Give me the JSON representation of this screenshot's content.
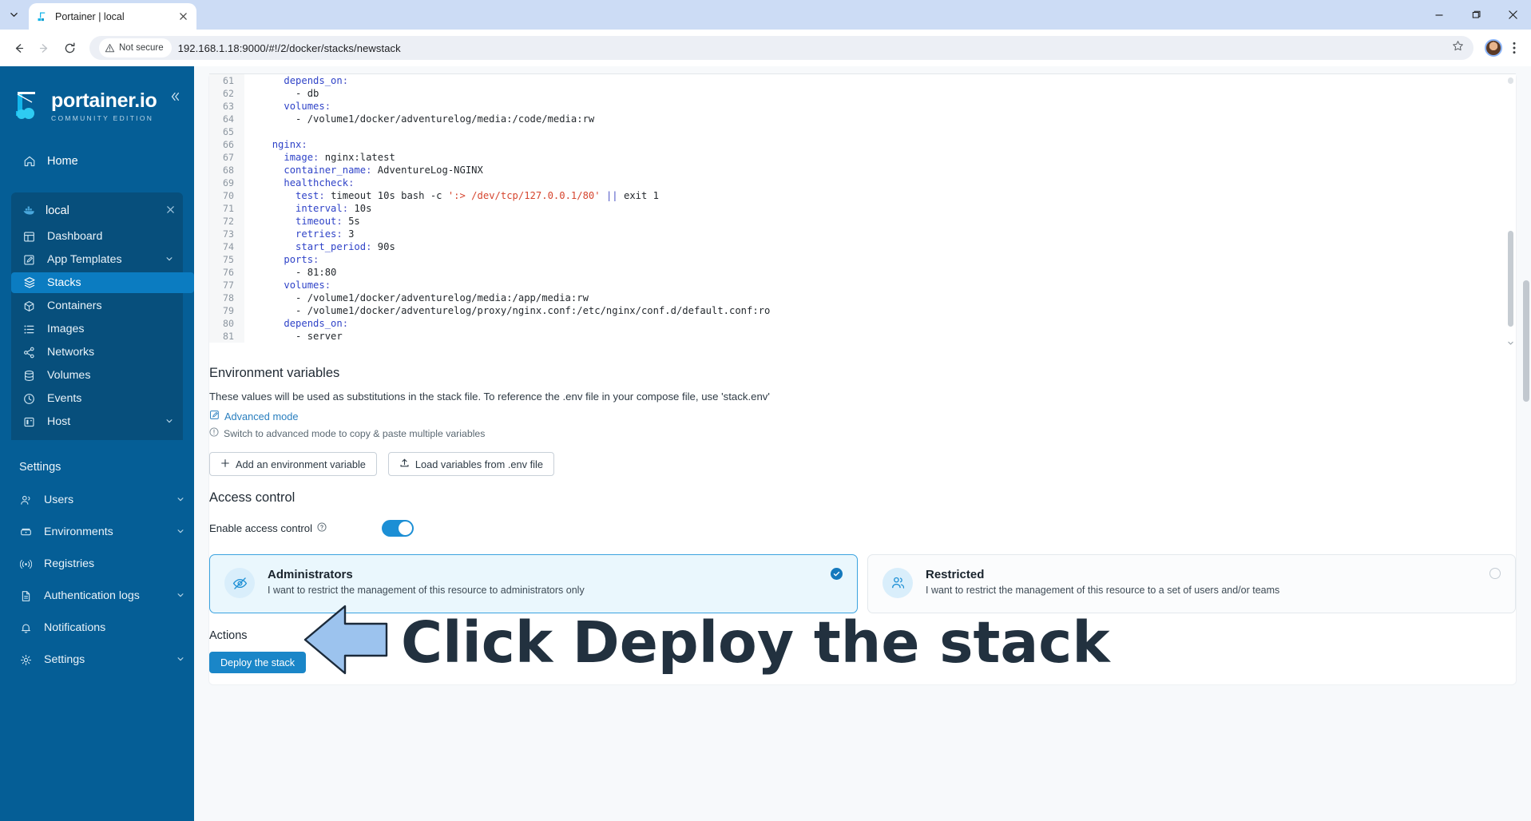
{
  "browser": {
    "tab": {
      "title": "Portainer | local",
      "favicon_icon": "portainer-favicon",
      "close_icon": "close-icon"
    },
    "tab_list_icon": "chevron-down-icon",
    "window": {
      "minimize_icon": "minimize-icon",
      "maximize_icon": "maximize-icon",
      "close_icon": "window-close-icon"
    },
    "nav": {
      "back_icon": "back-arrow-icon",
      "forward_icon": "forward-arrow-icon",
      "reload_icon": "reload-icon"
    },
    "omnibox": {
      "security_label": "Not secure",
      "security_icon": "warning-triangle-icon",
      "url": "192.168.1.18:9000/#!/2/docker/stacks/newstack",
      "bookmark_icon": "star-icon"
    },
    "profile_icon": "avatar",
    "menu_icon": "kebab-menu-icon"
  },
  "sidebar": {
    "logo": {
      "name": "portainer.io",
      "edition": "COMMUNITY EDITION",
      "icon": "portainer-logo-icon"
    },
    "collapse_icon": "chevron-double-left-icon",
    "home": {
      "label": "Home",
      "icon": "home-icon"
    },
    "environment": {
      "name": "local",
      "icon": "docker-icon",
      "close_icon": "close-icon"
    },
    "env_items": [
      {
        "label": "Dashboard",
        "icon": "dashboard-icon",
        "active": false
      },
      {
        "label": "App Templates",
        "icon": "template-icon",
        "active": false,
        "chevron": "chevron-down-icon"
      },
      {
        "label": "Stacks",
        "icon": "stacks-icon",
        "active": true
      },
      {
        "label": "Containers",
        "icon": "container-icon",
        "active": false
      },
      {
        "label": "Images",
        "icon": "images-icon",
        "active": false
      },
      {
        "label": "Networks",
        "icon": "networks-icon",
        "active": false
      },
      {
        "label": "Volumes",
        "icon": "volumes-icon",
        "active": false
      },
      {
        "label": "Events",
        "icon": "clock-icon",
        "active": false
      },
      {
        "label": "Host",
        "icon": "host-icon",
        "active": false,
        "chevron": "chevron-down-icon"
      }
    ],
    "settings_label": "Settings",
    "settings_items": [
      {
        "label": "Users",
        "icon": "users-icon",
        "chevron": "chevron-down-icon"
      },
      {
        "label": "Environments",
        "icon": "environments-icon",
        "chevron": "chevron-down-icon"
      },
      {
        "label": "Registries",
        "icon": "registries-icon"
      },
      {
        "label": "Authentication logs",
        "icon": "document-icon",
        "chevron": "chevron-down-icon"
      },
      {
        "label": "Notifications",
        "icon": "bell-icon"
      },
      {
        "label": "Settings",
        "icon": "gear-icon",
        "chevron": "chevron-down-icon"
      }
    ]
  },
  "editor": {
    "lines": [
      {
        "n": "61",
        "html": "    <span class='k'>depends_on</span><span class='op'>:</span>"
      },
      {
        "n": "62",
        "html": "      - <span class='v'>db</span>"
      },
      {
        "n": "63",
        "html": "    <span class='k'>volumes</span><span class='op'>:</span>"
      },
      {
        "n": "64",
        "html": "      - <span class='v'>/volume1/docker/adventurelog/media:/code/media:rw</span>"
      },
      {
        "n": "65",
        "html": ""
      },
      {
        "n": "66",
        "html": "  <span class='k'>nginx</span><span class='op'>:</span>"
      },
      {
        "n": "67",
        "html": "    <span class='k'>image</span><span class='op'>:</span> <span class='v'>nginx:latest</span>"
      },
      {
        "n": "68",
        "html": "    <span class='k'>container_name</span><span class='op'>:</span> <span class='v'>AdventureLog-NGINX</span>"
      },
      {
        "n": "69",
        "html": "    <span class='k'>healthcheck</span><span class='op'>:</span>"
      },
      {
        "n": "70",
        "html": "      <span class='k'>test</span><span class='op'>:</span> <span class='v'>timeout 10s bash -c </span><span class='s'>':&gt; /dev/tcp/127.0.0.1/80'</span> <span class='op'>||</span> <span class='v'>exit 1</span>"
      },
      {
        "n": "71",
        "html": "      <span class='k'>interval</span><span class='op'>:</span> <span class='v'>10s</span>"
      },
      {
        "n": "72",
        "html": "      <span class='k'>timeout</span><span class='op'>:</span> <span class='v'>5s</span>"
      },
      {
        "n": "73",
        "html": "      <span class='k'>retries</span><span class='op'>:</span> <span class='v'>3</span>"
      },
      {
        "n": "74",
        "html": "      <span class='k'>start_period</span><span class='op'>:</span> <span class='v'>90s</span>"
      },
      {
        "n": "75",
        "html": "    <span class='k'>ports</span><span class='op'>:</span>"
      },
      {
        "n": "76",
        "html": "      - <span class='v'>81:80</span>"
      },
      {
        "n": "77",
        "html": "    <span class='k'>volumes</span><span class='op'>:</span>"
      },
      {
        "n": "78",
        "html": "      - <span class='v'>/volume1/docker/adventurelog/media:/app/media:rw</span>"
      },
      {
        "n": "79",
        "html": "      - <span class='v'>/volume1/docker/adventurelog/proxy/nginx.conf:/etc/nginx/conf.d/default.conf:ro</span>"
      },
      {
        "n": "80",
        "html": "    <span class='k'>depends_on</span><span class='op'>:</span>"
      },
      {
        "n": "81",
        "html": "      - <span class='v'>server</span>"
      }
    ],
    "scroll_down_icon": "chevron-down-icon"
  },
  "env_vars": {
    "title": "Environment variables",
    "description": "These values will be used as substitutions in the stack file. To reference the .env file in your compose file, use 'stack.env'",
    "advanced_link": "Advanced mode",
    "advanced_icon": "edit-icon",
    "hint": "Switch to advanced mode to copy & paste multiple variables",
    "hint_icon": "info-icon",
    "add_button": "Add an environment variable",
    "add_icon": "plus-icon",
    "load_button": "Load variables from .env file",
    "load_icon": "upload-icon"
  },
  "access_control": {
    "title": "Access control",
    "toggle_label": "Enable access control",
    "toggle_help_icon": "question-circle-icon",
    "toggle_on": true,
    "options": [
      {
        "title": "Administrators",
        "subtitle": "I want to restrict the management of this resource to administrators only",
        "icon": "eye-off-icon",
        "selected": true,
        "check_icon": "check-circle-icon"
      },
      {
        "title": "Restricted",
        "subtitle": "I want to restrict the management of this resource to a set of users and/or teams",
        "icon": "users-group-icon",
        "selected": false
      }
    ]
  },
  "actions": {
    "title": "Actions",
    "deploy_button": "Deploy the stack"
  },
  "annotation": {
    "text": "Click Deploy the stack",
    "arrow_icon": "left-arrow-annotation",
    "arrow_fill": "#9cc3ee",
    "arrow_stroke": "#1b2a3a",
    "text_color": "#22313f"
  },
  "colors": {
    "sidebar_bg": "#055e96",
    "sidebar_active": "#0b7cc1",
    "accent": "#1a86c8",
    "card_selected_bg": "#eaf7fd",
    "keyword": "#2f43c8",
    "string": "#d6452e"
  }
}
